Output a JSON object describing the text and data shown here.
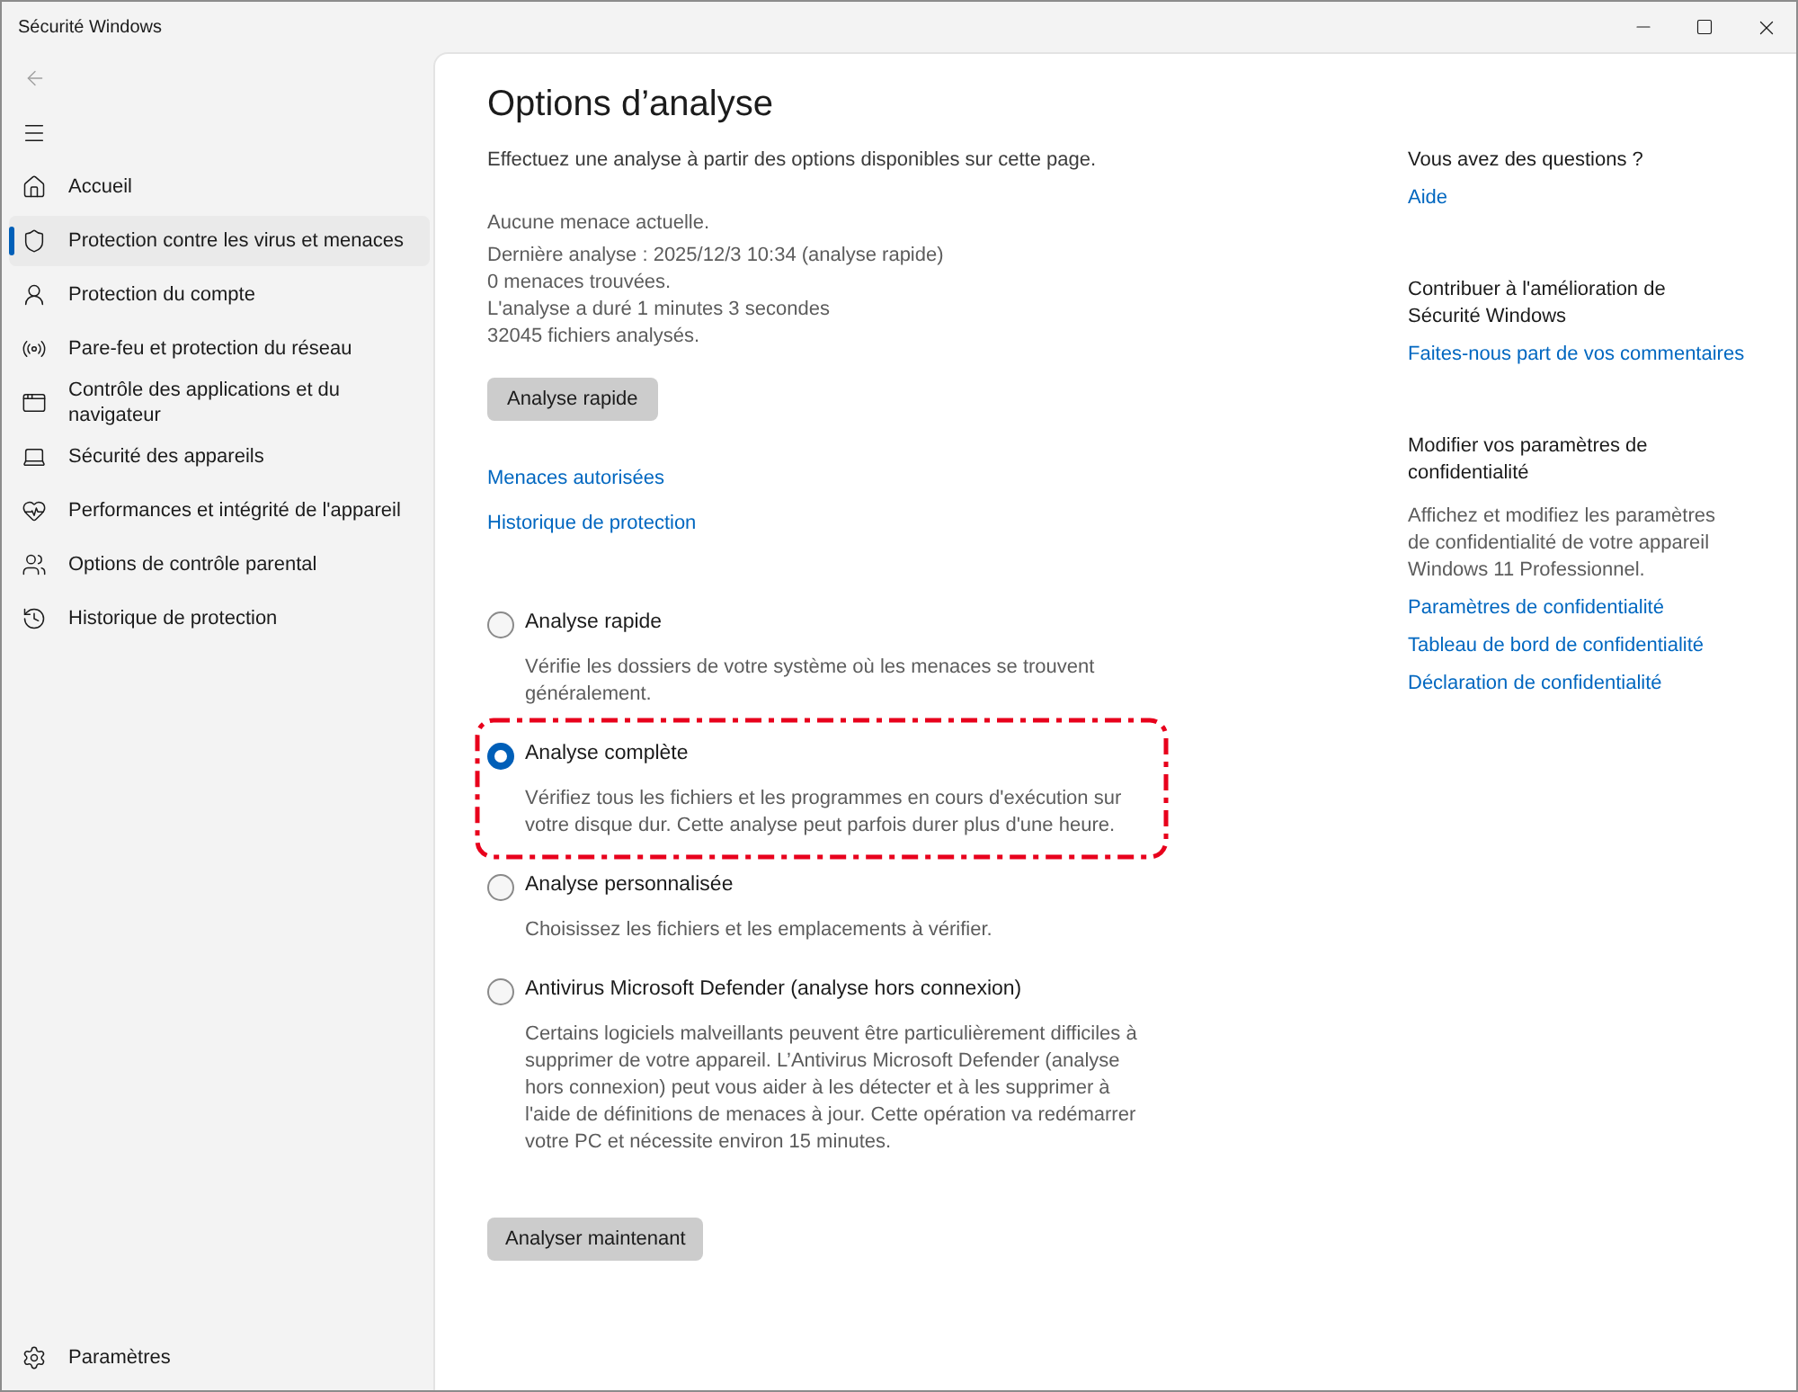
{
  "window": {
    "title": "Sécurité Windows"
  },
  "sidebar": {
    "items": [
      {
        "label": "Accueil",
        "selected": false
      },
      {
        "label": "Protection contre les virus et menaces",
        "selected": true
      },
      {
        "label": "Protection du compte",
        "selected": false
      },
      {
        "label": "Pare-feu et protection du réseau",
        "selected": false
      },
      {
        "label": "Contrôle des applications et du navigateur",
        "selected": false
      },
      {
        "label": "Sécurité des appareils",
        "selected": false
      },
      {
        "label": "Performances et intégrité de l'appareil",
        "selected": false
      },
      {
        "label": "Options de contrôle parental",
        "selected": false
      },
      {
        "label": "Historique de protection",
        "selected": false
      }
    ],
    "footer_item": {
      "label": "Paramètres"
    }
  },
  "page": {
    "title": "Options d’analyse",
    "subtitle": "Effectuez une analyse à partir des options disponibles sur cette page.",
    "status_lines": [
      "Aucune menace actuelle.",
      "Dernière analyse : 2025/12/3 10:34 (analyse rapide)",
      "0 menaces trouvées.",
      "L'analyse a duré 1 minutes 3 secondes",
      "32045 fichiers analysés."
    ],
    "quick_scan_button": "Analyse rapide",
    "links": [
      "Menaces autorisées",
      "Historique de protection"
    ],
    "scan_options": [
      {
        "label": "Analyse rapide",
        "description": "Vérifie les dossiers de votre système où les menaces se trouvent généralement.",
        "selected": false,
        "highlighted": false
      },
      {
        "label": "Analyse complète",
        "description": "Vérifiez tous les fichiers et les programmes en cours d'exécution sur votre disque dur. Cette analyse peut parfois durer plus d'une heure.",
        "selected": true,
        "highlighted": true
      },
      {
        "label": "Analyse personnalisée",
        "description": "Choisissez les fichiers et les emplacements à vérifier.",
        "selected": false,
        "highlighted": false
      },
      {
        "label": "Antivirus Microsoft Defender (analyse hors connexion)",
        "description": "Certains logiciels malveillants peuvent être particulièrement difficiles à supprimer de votre appareil. L’Antivirus Microsoft Defender (analyse hors connexion) peut vous aider à les détecter et à les supprimer à l'aide de définitions de menaces à jour. Cette opération va redémarrer votre PC et nécessite environ 15 minutes.",
        "selected": false,
        "highlighted": false
      }
    ],
    "scan_button": "Analyser maintenant"
  },
  "help_panel": {
    "sections": [
      {
        "heading": "Vous avez des questions ?",
        "links": [
          "Aide"
        ]
      },
      {
        "heading": "Contribuer à l'amélioration de Sécurité Windows",
        "links": [
          "Faites-nous part de vos commentaires"
        ]
      },
      {
        "heading": "Modifier vos paramètres de confidentialité",
        "description": "Affichez et modifiez les paramètres de confidentialité de votre appareil Windows 11 Professionnel.",
        "links": [
          "Paramètres de confidentialité",
          "Tableau de bord de confidentialité",
          "Déclaration de confidentialité"
        ]
      }
    ]
  }
}
